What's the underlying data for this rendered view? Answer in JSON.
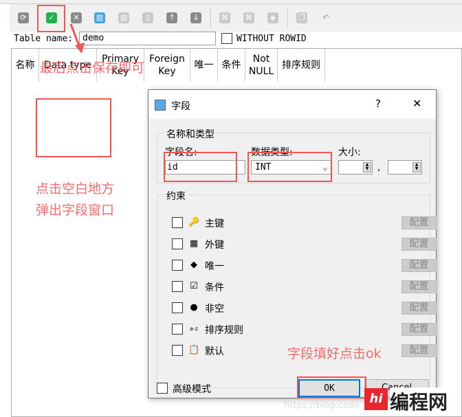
{
  "toolbar": {
    "icons": [
      "refresh-icon",
      "save-check-icon",
      "close-icon",
      "add-field-icon",
      "insert-field-icon",
      "delete-field-icon",
      "move-up-icon",
      "move-down-icon",
      "add-index-icon",
      "delete-index-icon",
      "copy-icon",
      "copy-table-icon",
      "undo-icon"
    ],
    "accent_save": "#22b14c"
  },
  "table": {
    "name_label": "Table name:",
    "name_value": "demo",
    "without_rowid": "WITHOUT ROWID",
    "columns": [
      "名称",
      "Data type",
      "Primary Key",
      "Foreign Key",
      "唯一",
      "条件",
      "Not NULL",
      "排序规则"
    ]
  },
  "annotations": {
    "save_hint": "最后点击保存即可",
    "blank_hint_1": "点击空白地方",
    "blank_hint_2": "弹出字段窗口",
    "ok_hint": "字段填好点击ok",
    "color": "#f25454"
  },
  "dialog": {
    "title": "字段",
    "help": "?",
    "close": "✕",
    "group_name_type": "名称和类型",
    "field_name_label": "字段名:",
    "field_name_value": "id",
    "data_type_label": "数据类型:",
    "data_type_value": "INT",
    "size_label": "大小:",
    "size_sep": ",",
    "group_constraints": "约束",
    "constraints": [
      {
        "label": "主键",
        "icon": "key-icon",
        "glyph": "🔑"
      },
      {
        "label": "外键",
        "icon": "foreign-key-icon",
        "glyph": "▦"
      },
      {
        "label": "唯一",
        "icon": "unique-icon",
        "glyph": "◆"
      },
      {
        "label": "条件",
        "icon": "check-icon",
        "glyph": "☑"
      },
      {
        "label": "非空",
        "icon": "not-null-icon",
        "glyph": "●"
      },
      {
        "label": "排序规则",
        "icon": "collation-icon",
        "glyph": "a-z"
      },
      {
        "label": "默认",
        "icon": "default-clipboard-icon",
        "glyph": "📋"
      }
    ],
    "configure": "配置",
    "advanced_mode": "高级模式",
    "ok": "OK",
    "cancel": "Cancel"
  },
  "watermark": {
    "url": "https://blog.csdn",
    "logo": "编程网"
  }
}
